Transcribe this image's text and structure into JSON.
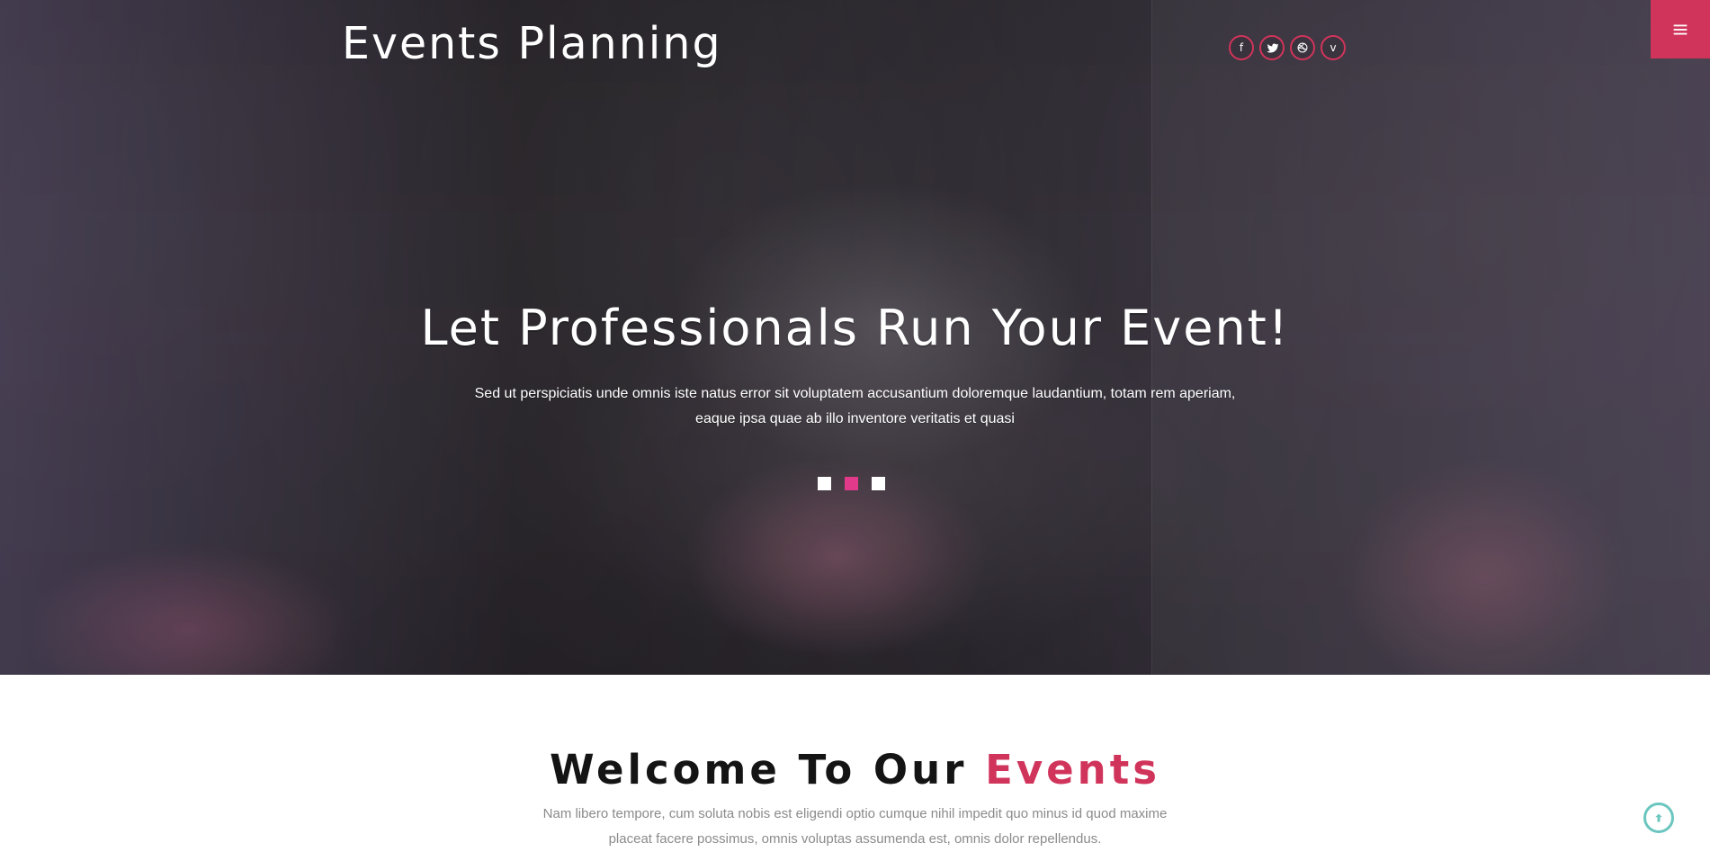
{
  "header": {
    "brand": "Events Planning",
    "social": [
      {
        "icon": "facebook-icon",
        "glyph": "f"
      },
      {
        "icon": "twitter-icon",
        "glyph": ""
      },
      {
        "icon": "dribbble-icon",
        "glyph": ""
      },
      {
        "icon": "vimeo-icon",
        "glyph": "v"
      }
    ],
    "accent_color": "#d1345b"
  },
  "hero": {
    "title": "Let Professionals Run Your Event!",
    "subtitle": "Sed ut perspiciatis unde omnis iste natus error sit voluptatem accusantium doloremque laudantium, totam rem aperiam, eaque ipsa quae ab illo inventore veritatis et quasi",
    "slider": {
      "count": 3,
      "active_index": 1,
      "active_color": "#e23a8a"
    }
  },
  "welcome": {
    "title_prefix": "Welcome To Our ",
    "title_accent": "Events",
    "body": "Nam libero tempore, cum soluta nobis est eligendi optio cumque nihil impedit quo minus id quod maxime placeat facere possimus, omnis voluptas assumenda est, omnis dolor repellendus."
  },
  "ui": {
    "menu_icon": "menu-icon",
    "to_top_icon": "arrow-up-icon",
    "to_top_color": "#6ac6be"
  }
}
